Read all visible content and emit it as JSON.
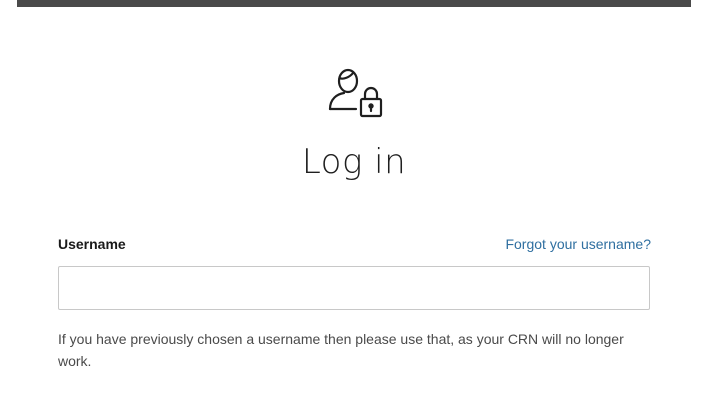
{
  "header": {
    "icon": "user-lock-icon",
    "title": "Log in"
  },
  "form": {
    "username_label": "Username",
    "forgot_link": "Forgot your username?",
    "username_value": "",
    "username_placeholder": "",
    "help_text": "If you have previously chosen a username then please use that, as your CRN will no longer work."
  },
  "colors": {
    "top_bar": "#4a4a4a",
    "link": "#2f6fa0",
    "input_border": "#c8c8c8"
  }
}
